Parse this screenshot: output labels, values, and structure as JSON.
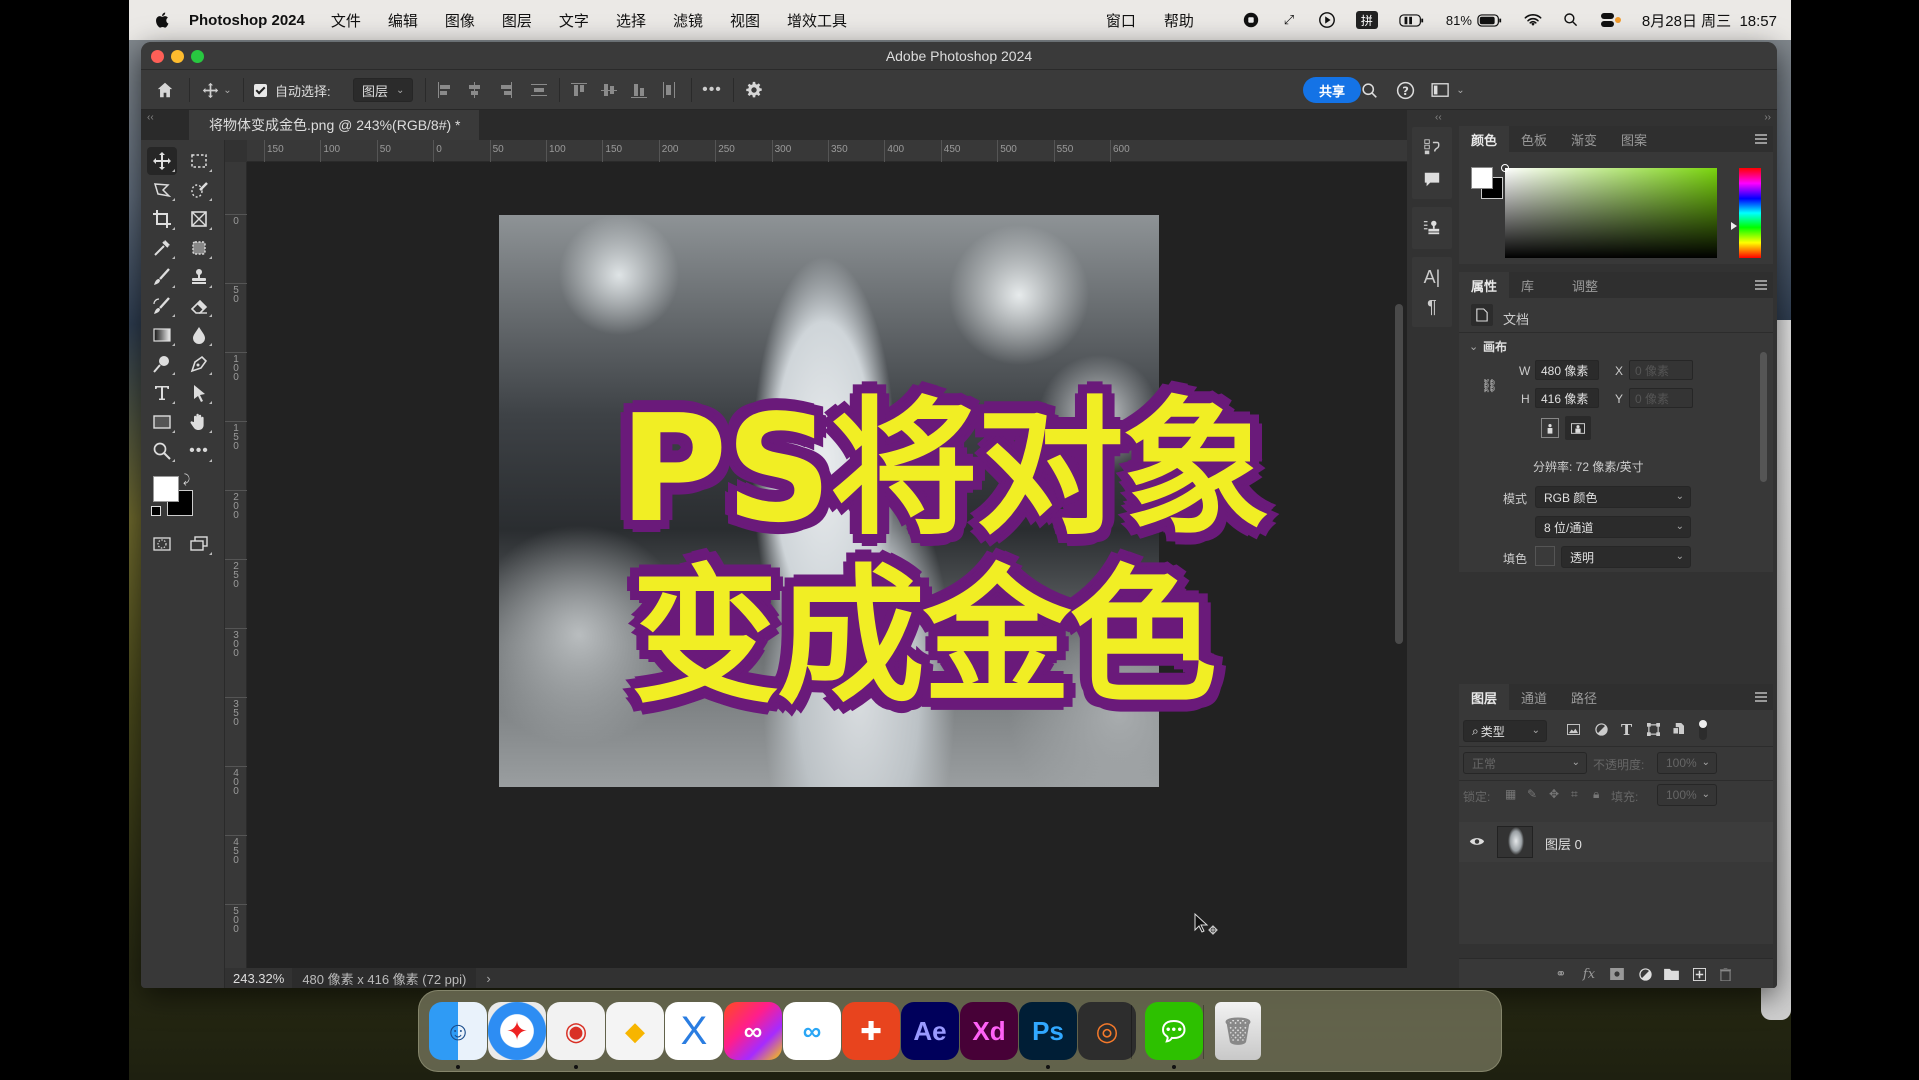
{
  "menubar": {
    "app_name": "Photoshop 2024",
    "items": [
      "文件",
      "编辑",
      "图像",
      "图层",
      "文字",
      "选择",
      "滤镜",
      "视图",
      "增效工具"
    ],
    "right_items": [
      "窗口",
      "帮助"
    ],
    "ime": "拼",
    "battery": "81%",
    "datetime": "8月28日 周三  18:57"
  },
  "window": {
    "title": "Adobe Photoshop 2024",
    "traffic_colors": [
      "#fe5f57",
      "#febc2e",
      "#28c840"
    ]
  },
  "options_bar": {
    "auto_select_label": "自动选择:",
    "auto_select_checked": true,
    "auto_select_target": "图层",
    "share_label": "共享",
    "share_color": "#1473e6"
  },
  "document": {
    "tab_title": "将物体变成金色.png @ 243%(RGB/8#) *",
    "overlay_lines": [
      "PS将对象",
      "变成金色"
    ],
    "overlay_fill": "#f1ee24",
    "overlay_stroke": "#6a1a7a"
  },
  "rulers": {
    "horizontal": [
      "150",
      "100",
      "50",
      "0",
      "50",
      "100",
      "150",
      "200",
      "250",
      "300",
      "350",
      "400",
      "450",
      "500",
      "550",
      "600"
    ],
    "vertical": [
      "0",
      "50",
      "100",
      "150",
      "200",
      "250",
      "300",
      "350",
      "400",
      "450",
      "500"
    ]
  },
  "status": {
    "zoom": "243.32%",
    "doc_info": "480 像素 x 416 像素 (72 ppi)",
    "arrow": "›"
  },
  "color_panel": {
    "tabs": [
      "颜色",
      "色板",
      "渐变",
      "图案"
    ],
    "active_tab": 0,
    "foreground": "#ffffff",
    "background": "#000000"
  },
  "properties_panel": {
    "tabs": [
      "属性",
      "库",
      "调整"
    ],
    "active_tab": 0,
    "doc_label": "文档",
    "section": "画布",
    "w_label": "W",
    "w_value": "480 像素",
    "h_label": "H",
    "h_value": "416 像素",
    "x_label": "X",
    "x_placeholder": "0 像素",
    "y_label": "Y",
    "y_placeholder": "0 像素",
    "resolution": "分辨率: 72 像素/英寸",
    "mode_label": "模式",
    "mode_value": "RGB 颜色",
    "depth_value": "8 位/通道",
    "fill_label": "填色",
    "fill_value": "透明"
  },
  "layers_panel": {
    "tabs": [
      "图层",
      "通道",
      "路径"
    ],
    "active_tab": 0,
    "filter_label": "类型",
    "blend_mode": "正常",
    "opacity_label": "不透明度:",
    "opacity_value": "100%",
    "lock_label": "锁定:",
    "fill_label": "填充:",
    "fill_value": "100%",
    "layers": [
      {
        "name": "图层 0",
        "visible": true
      }
    ]
  },
  "dock": {
    "apps": [
      {
        "name": "Finder",
        "label": "",
        "running": true
      },
      {
        "name": "Safari",
        "label": "",
        "running": false
      },
      {
        "name": "Chrome",
        "label": "",
        "running": true
      },
      {
        "name": "Sketch",
        "label": "",
        "running": false
      },
      {
        "name": "Axure",
        "label": "X",
        "running": false
      },
      {
        "name": "Creative Cloud",
        "label": "",
        "running": false
      },
      {
        "name": "Baidu Netdisk",
        "label": "",
        "running": false
      },
      {
        "name": "Xmind",
        "label": "",
        "running": false
      },
      {
        "name": "After Effects",
        "label": "Ae",
        "running": false
      },
      {
        "name": "Adobe XD",
        "label": "Xd",
        "running": false
      },
      {
        "name": "Photoshop",
        "label": "Ps",
        "running": true
      },
      {
        "name": "Blender",
        "label": "",
        "running": false
      },
      {
        "name": "WeChat",
        "label": "",
        "running": true
      },
      {
        "name": "Trash",
        "label": "",
        "running": false
      }
    ]
  }
}
